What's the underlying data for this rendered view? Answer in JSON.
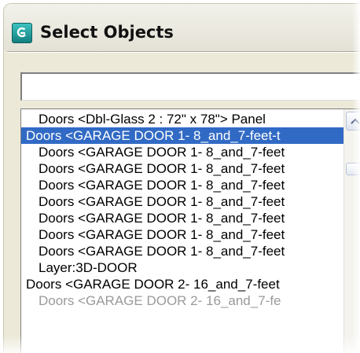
{
  "window": {
    "title": "Select Objects",
    "app_icon": "3ds-max-logo-icon"
  },
  "filter": {
    "value": ""
  },
  "list": {
    "items": [
      {
        "label": "Doors <Dbl-Glass 2 : 72\" x 78\"> Panel",
        "indent": 1,
        "selected": false
      },
      {
        "label": "Doors <GARAGE DOOR 1- 8_and_7-feet-t",
        "indent": 0,
        "selected": true
      },
      {
        "label": "Doors <GARAGE DOOR 1- 8_and_7-feet",
        "indent": 1,
        "selected": false
      },
      {
        "label": "Doors <GARAGE DOOR 1- 8_and_7-feet",
        "indent": 1,
        "selected": false
      },
      {
        "label": "Doors <GARAGE DOOR 1- 8_and_7-feet",
        "indent": 1,
        "selected": false
      },
      {
        "label": "Doors <GARAGE DOOR 1- 8_and_7-feet",
        "indent": 1,
        "selected": false
      },
      {
        "label": "Doors <GARAGE DOOR 1- 8_and_7-feet",
        "indent": 1,
        "selected": false
      },
      {
        "label": "Doors <GARAGE DOOR 1- 8_and_7-feet",
        "indent": 1,
        "selected": false
      },
      {
        "label": "Doors <GARAGE DOOR 1- 8_and_7-feet",
        "indent": 1,
        "selected": false
      },
      {
        "label": "Layer:3D-DOOR",
        "indent": 1,
        "selected": false
      },
      {
        "label": "Doors <GARAGE DOOR 2- 16_and_7-feet",
        "indent": 0,
        "selected": false
      },
      {
        "label": "Doors <GARAGE DOOR 2- 16_and_7-fe",
        "indent": 1,
        "selected": false,
        "faded": true
      }
    ]
  },
  "colors": {
    "selection": "#316ac5",
    "window_bg": "#ece9d8"
  }
}
